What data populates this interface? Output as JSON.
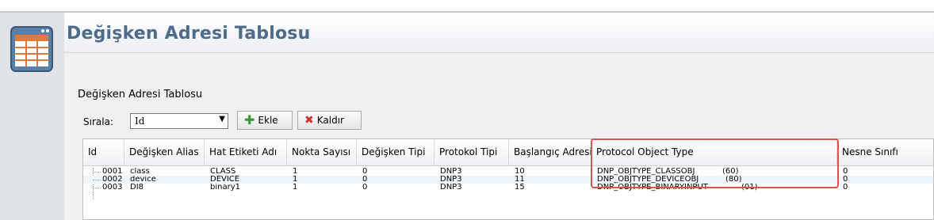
{
  "page": {
    "title": "Değişken Adresi Tablosu"
  },
  "section": {
    "title": "Değişken Adresi Tablosu"
  },
  "toolbar": {
    "sort_label": "Sırala:",
    "sort_value": "Id",
    "add_label": "Ekle",
    "remove_label": "Kaldır"
  },
  "table": {
    "columns": [
      "Id",
      "Değişken Alias",
      "Hat Etiketi Adı",
      "Nokta Sayısı",
      "Değişken Tipi",
      "Protokol Tipi",
      "Başlangıç Adresi",
      "Protocol Object Type",
      "Nesne Sınıfı"
    ],
    "rows": [
      [
        "0001",
        "class",
        "CLASS",
        "1",
        "0",
        "DNP3",
        "10",
        "DNP_OBJTYPE_CLASSOBJ",
        "(60)",
        "0"
      ],
      [
        "0002",
        "device",
        "DEVICE",
        "1",
        "0",
        "DNP3",
        "11",
        "DNP_OBJTYPE_DEVICEOBJ",
        "(80)",
        "0"
      ],
      [
        "0003",
        "DI8",
        "binary1",
        "1",
        "0",
        "DNP3",
        "15",
        "DNP_OBJTYPE_BINARYINPUT",
        "(01)",
        "0"
      ]
    ]
  },
  "colors": {
    "title": "#4d6b8a",
    "highlight": "#d9534f",
    "add": "#2e9e2e",
    "remove": "#d53030"
  }
}
